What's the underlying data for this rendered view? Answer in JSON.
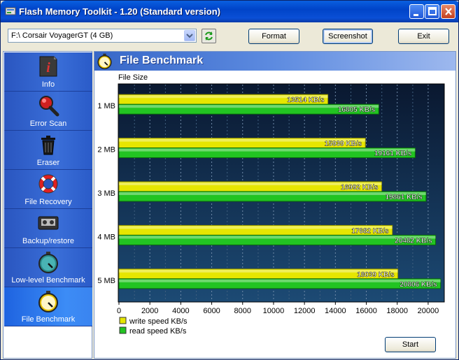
{
  "window": {
    "title": "Flash Memory Toolkit - 1.20 (Standard version)"
  },
  "toolbar": {
    "drive_value": "F:\\ Corsair VoyagerGT (4 GB)",
    "format_label": "Format",
    "screenshot_label": "Screenshot",
    "exit_label": "Exit"
  },
  "sidebar": {
    "items": [
      {
        "label": "Info",
        "icon": "info-icon"
      },
      {
        "label": "Error Scan",
        "icon": "magnifier-icon"
      },
      {
        "label": "Eraser",
        "icon": "trash-icon"
      },
      {
        "label": "File Recovery",
        "icon": "lifebuoy-icon"
      },
      {
        "label": "Backup/restore",
        "icon": "tape-icon"
      },
      {
        "label": "Low-level Benchmark",
        "icon": "stopwatch-icon"
      },
      {
        "label": "File Benchmark",
        "icon": "stopwatch-icon"
      }
    ],
    "active": "File Benchmark"
  },
  "panel": {
    "title": "File Benchmark",
    "start_label": "Start"
  },
  "colors": {
    "write": "#e6e600",
    "read": "#22c422",
    "plot_bg_top": "#0a1830",
    "plot_bg_bottom": "#1c4a74"
  },
  "chart_data": {
    "type": "bar",
    "orientation": "horizontal",
    "ylabel": "File Size",
    "categories": [
      "1 MB",
      "2 MB",
      "3 MB",
      "4 MB",
      "5 MB"
    ],
    "series": [
      {
        "name": "write speed KB/s",
        "values": [
          13514,
          15939,
          16992,
          17682,
          18039
        ],
        "labels": [
          "13514 KB/s",
          "15939 KB/s",
          "16992 KB/s",
          "17682 KB/s",
          "18039 KB/s"
        ]
      },
      {
        "name": "read speed KB/s",
        "values": [
          16805,
          19161,
          19861,
          20482,
          20806
        ],
        "labels": [
          "16805 KB/s",
          "19161 KB/s",
          "19861 KB/s",
          "20482 KB/s",
          "20806 KB/s"
        ]
      }
    ],
    "xlim": [
      0,
      21000
    ],
    "xticks": [
      "0",
      "2000",
      "4000",
      "6000",
      "8000",
      "10000",
      "12000",
      "14000",
      "16000",
      "18000",
      "20000"
    ],
    "grid": true,
    "legend": "bottom-left"
  }
}
